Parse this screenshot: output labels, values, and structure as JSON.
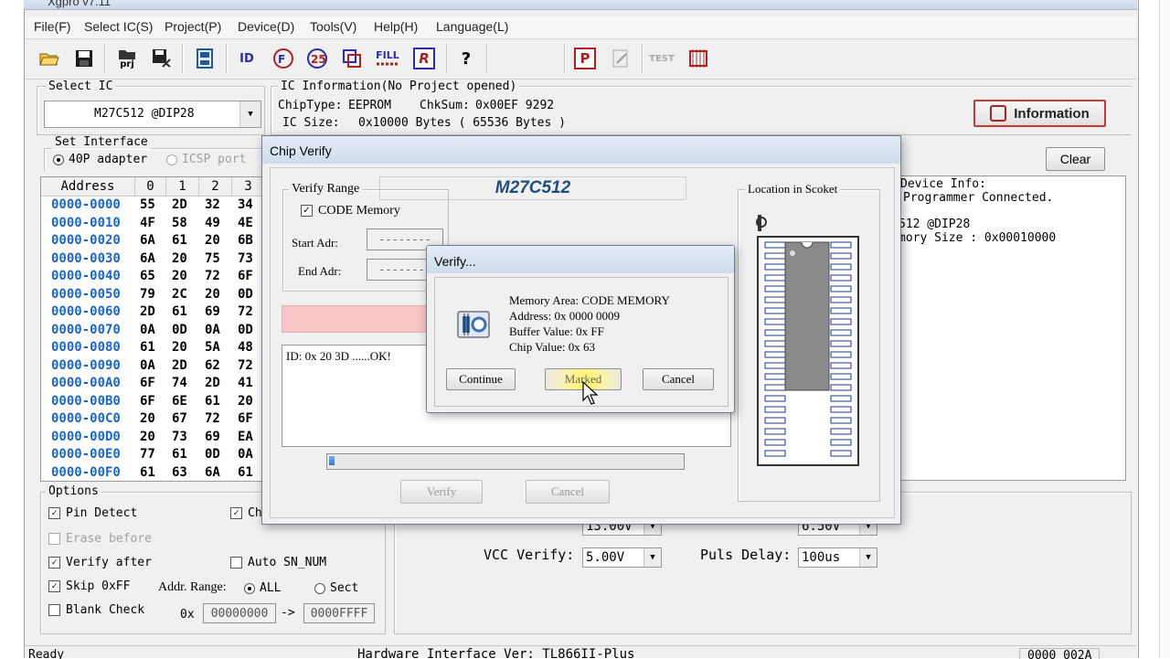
{
  "window": {
    "title": "Xgpro v7.11"
  },
  "menu": [
    "File(F)",
    "Select IC(S)",
    "Project(P)",
    "Device(D)",
    "Tools(V)",
    "Help(H)",
    "Language(L)"
  ],
  "toolbar": {
    "prj_label": "prj",
    "id_label": "ID",
    "fill_label": "FILL",
    "r_label": "R",
    "p_label": "P",
    "test_label": "TEST"
  },
  "select_ic": {
    "label": "Select IC",
    "value": "M27C512 @DIP28"
  },
  "ic_info": {
    "label": "IC Information(No Project opened)",
    "chip_type_label": "ChipType:",
    "chip_type": "EEPROM",
    "chksum_label": "ChkSum:",
    "chksum": "0x00EF 9292",
    "ic_size_label": "IC Size:",
    "ic_size": "0x10000 Bytes ( 65536 Bytes )"
  },
  "information_button": "Information",
  "clear_button": "Clear",
  "set_interface": {
    "label": "Set Interface",
    "opt1": "40P adapter",
    "opt2": "ICSP port"
  },
  "hex": {
    "headers": [
      "Address",
      "0",
      "1",
      "2",
      "3"
    ],
    "rows": [
      {
        "addr": "0000-0000",
        "b": [
          "55",
          "2D",
          "32",
          "34"
        ]
      },
      {
        "addr": "0000-0010",
        "b": [
          "4F",
          "58",
          "49",
          "4E"
        ]
      },
      {
        "addr": "0000-0020",
        "b": [
          "6A",
          "61",
          "20",
          "6B"
        ]
      },
      {
        "addr": "0000-0030",
        "b": [
          "6A",
          "20",
          "75",
          "73"
        ]
      },
      {
        "addr": "0000-0040",
        "b": [
          "65",
          "20",
          "72",
          "6F"
        ]
      },
      {
        "addr": "0000-0050",
        "b": [
          "79",
          "2C",
          "20",
          "0D"
        ]
      },
      {
        "addr": "0000-0060",
        "b": [
          "2D",
          "61",
          "69",
          "72"
        ]
      },
      {
        "addr": "0000-0070",
        "b": [
          "0A",
          "0D",
          "0A",
          "0D"
        ]
      },
      {
        "addr": "0000-0080",
        "b": [
          "61",
          "20",
          "5A",
          "48"
        ]
      },
      {
        "addr": "0000-0090",
        "b": [
          "0A",
          "2D",
          "62",
          "72"
        ]
      },
      {
        "addr": "0000-00A0",
        "b": [
          "6F",
          "74",
          "2D",
          "41"
        ]
      },
      {
        "addr": "0000-00B0",
        "b": [
          "6F",
          "6E",
          "61",
          "20"
        ]
      },
      {
        "addr": "0000-00C0",
        "b": [
          "20",
          "67",
          "72",
          "6F"
        ]
      },
      {
        "addr": "0000-00D0",
        "b": [
          "20",
          "73",
          "69",
          "EA"
        ]
      },
      {
        "addr": "0000-00E0",
        "b": [
          "77",
          "61",
          "0D",
          "0A"
        ]
      },
      {
        "addr": "0000-00F0",
        "b": [
          "61",
          "63",
          "6A",
          "61"
        ]
      }
    ]
  },
  "log": {
    "line1": "Device Info:",
    "line2": "Programmer Connected.",
    "line3": "512 @DIP28",
    "line4": "mory Size : 0x00010000"
  },
  "options": {
    "label": "Options",
    "pin_detect": "Pin Detect",
    "ch_partial": "Ch",
    "erase_before": "Erase before",
    "verify_after": "Verify after",
    "auto_sn": "Auto SN_NUM",
    "skip_ff": "Skip 0xFF",
    "addr_range": "Addr. Range:",
    "all": "ALL",
    "sect": "Sect",
    "blank_check": "Blank Check",
    "ox": "0x",
    "from": "00000000",
    "arrow": "->",
    "to": "0000FFFF"
  },
  "voltages": {
    "vpp_value": "13.00V",
    "vdd_value": "6.50V",
    "vcc_verify_label": "VCC Verify:",
    "vcc_verify_value": "5.00V",
    "puls_delay_label": "Puls Delay:",
    "puls_delay_value": "100us"
  },
  "status": {
    "left": "Ready",
    "center": "Hardware Interface Ver: TL866II-Plus",
    "right": "0000 002A"
  },
  "chip_verify": {
    "title": "Chip Verify",
    "chip_name": "M27C512",
    "verify_range": "Verify Range",
    "code_memory": "CODE Memory",
    "start_adr": "Start Adr:",
    "end_adr": "End Adr:",
    "placeholder": "--------",
    "location_label": "Location in Scoket",
    "log": "ID: 0x 20 3D ......OK!",
    "progress": 0.01,
    "verify_button": "Verify",
    "cancel_button": "Cancel"
  },
  "verify_dialog": {
    "title": "Verify...",
    "memory_area": "Memory Area: CODE MEMORY",
    "address": "Address: 0x 0000 0009",
    "buffer_value": "Buffer Value: 0x FF",
    "chip_value": "Chip Value: 0x 63",
    "continue": "Continue",
    "marked": "Marked",
    "cancel": "Cancel"
  }
}
